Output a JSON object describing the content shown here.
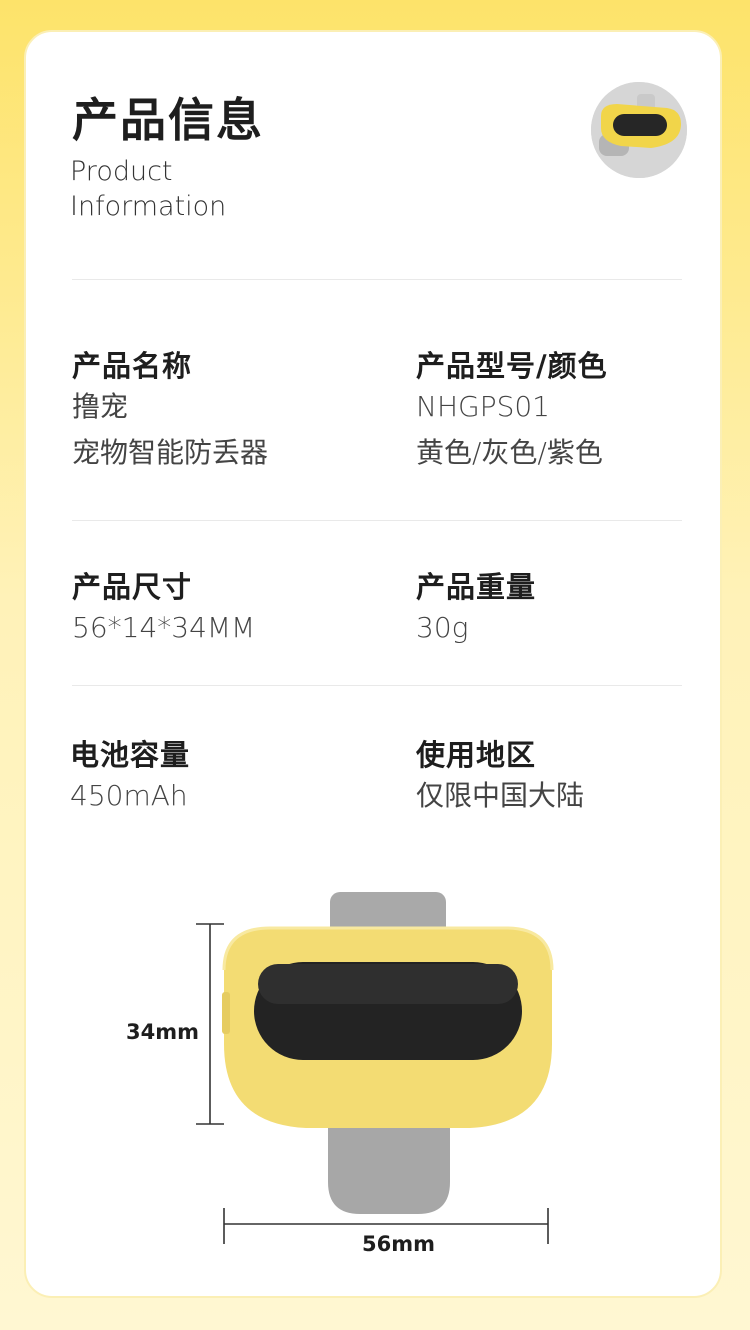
{
  "header": {
    "title_cn": "产品信息",
    "title_en_line1": "Product",
    "title_en_line2": "Information"
  },
  "specs": [
    {
      "label": "产品名称",
      "values": [
        "撸宠",
        "宠物智能防丢器"
      ]
    },
    {
      "label": "产品型号/颜色",
      "values": [
        "NHGPS01",
        "黄色/灰色/紫色"
      ]
    },
    {
      "label": "产品尺寸",
      "values": [
        "56*14*34MM"
      ]
    },
    {
      "label": "产品重量",
      "values": [
        "30g"
      ]
    },
    {
      "label": "电池容量",
      "values": [
        "450mAh"
      ]
    },
    {
      "label": "使用地区",
      "values": [
        "仅限中国大陆"
      ]
    }
  ],
  "diagram": {
    "height_label": "34mm",
    "width_label": "56mm"
  },
  "colors": {
    "device_yellow": "#f6e07a",
    "device_gray": "#a9a9a9",
    "screen_black": "#252525",
    "background_yellow": "#fde36a"
  }
}
